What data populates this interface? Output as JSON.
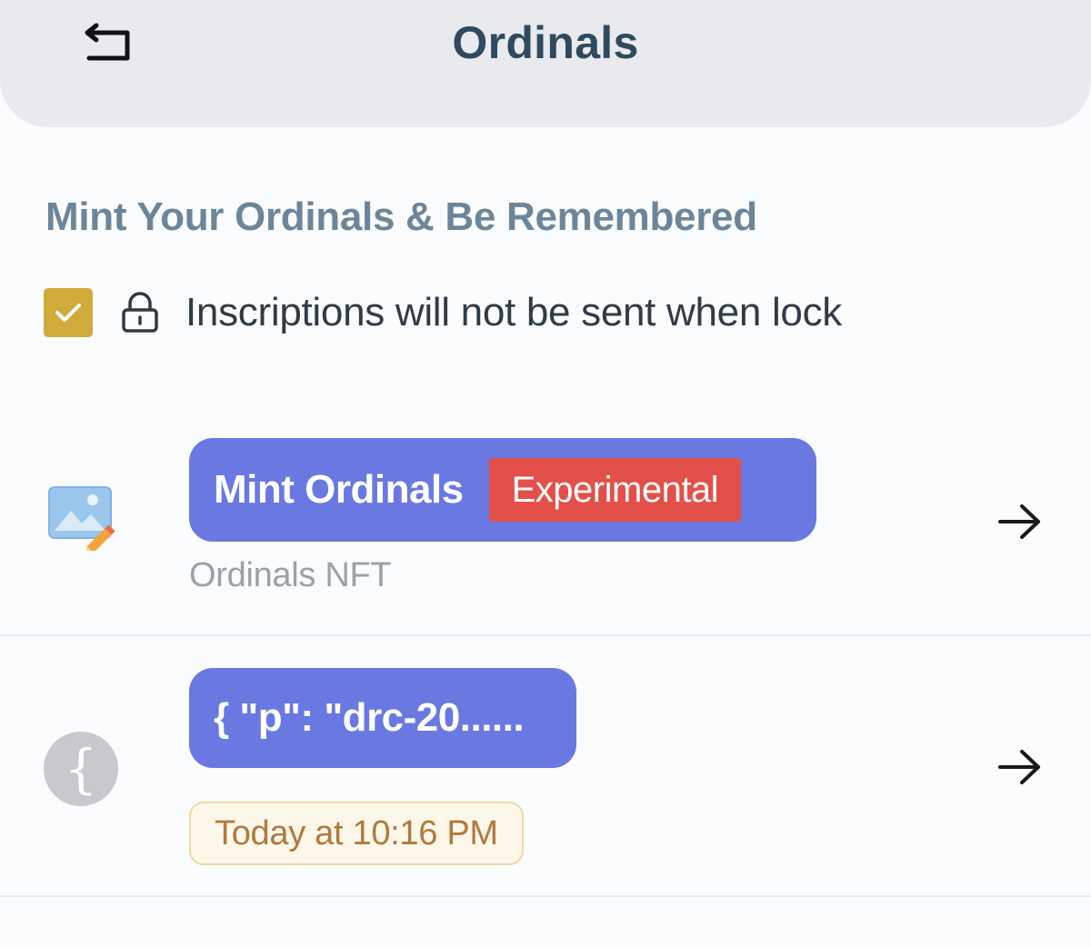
{
  "header": {
    "title": "Ordinals",
    "back_icon": "back-return-icon"
  },
  "section": {
    "title": "Mint Your Ordinals & Be Remembered"
  },
  "lock_option": {
    "checked": true,
    "icon": "lock-icon",
    "label": "Inscriptions will not be sent when lock"
  },
  "items": [
    {
      "icon": "image-edit-icon",
      "title": "Mint Ordinals",
      "badge": "Experimental",
      "subtitle": "Ordinals NFT",
      "arrow_icon": "arrow-right-icon"
    },
    {
      "icon": "curly-brace-icon",
      "icon_glyph": "{",
      "title": "{ \"p\": \"drc-20......",
      "time": "Today at 10:16 PM",
      "arrow_icon": "arrow-right-icon"
    }
  ],
  "colors": {
    "header_bg": "#e8eaee",
    "title_text": "#2f4a5e",
    "section_title": "#6c8599",
    "checkbox": "#cfab3c",
    "pill_bg": "#6a78e2",
    "badge_experimental": "#e3504a",
    "time_badge_text": "#b07a3d",
    "time_badge_bg": "#fdf7ea"
  }
}
